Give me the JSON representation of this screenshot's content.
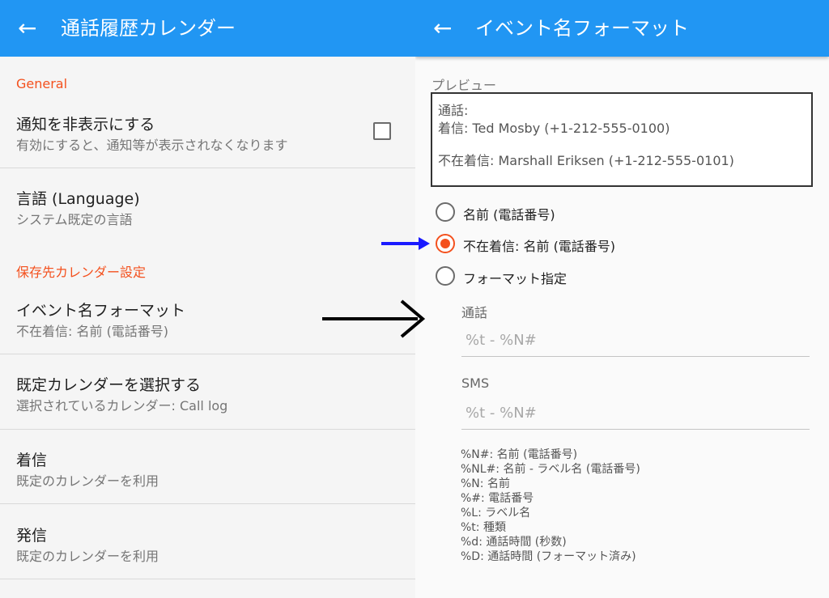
{
  "left_screen": {
    "title": "通話履歴カレンダー",
    "back_glyph": "←",
    "category_general": "General",
    "hide_notification": {
      "title": "通知を非表示にする",
      "summary": "有効にすると、通知等が表示されなくなります",
      "checked": false
    },
    "language": {
      "title": "言語 (Language)",
      "summary": "システム既定の言語"
    },
    "category_calendar": "保存先カレンダー設定",
    "event_name_format": {
      "title": "イベント名フォーマット",
      "summary": "不在着信: 名前 (電話番号)"
    },
    "default_calendar": {
      "title": "既定カレンダーを選択する",
      "summary": "選択されているカレンダー: Call log"
    },
    "incoming": {
      "title": "着信",
      "summary": "既定のカレンダーを利用"
    },
    "outgoing": {
      "title": "発信",
      "summary": "既定のカレンダーを利用"
    }
  },
  "right_screen": {
    "title": "イベント名フォーマット",
    "back_glyph": "←",
    "preview_label": "プレビュー",
    "preview_lines": [
      "通話:",
      "着信: Ted Mosby (+1-212-555-0100)",
      "不在着信: Marshall Eriksen (+1-212-555-0101)"
    ],
    "options": [
      {
        "label": "名前 (電話番号)",
        "selected": false
      },
      {
        "label": "不在着信: 名前 (電話番号)",
        "selected": true
      },
      {
        "label": "フォーマット指定",
        "selected": false
      }
    ],
    "call_field": {
      "label": "通話",
      "placeholder": "%t - %N#"
    },
    "sms_field": {
      "label": "SMS",
      "placeholder": "%t - %N#"
    },
    "help_lines": [
      "%N#: 名前 (電話番号)",
      "%NL#: 名前 - ラベル名 (電話番号)",
      "%N: 名前",
      "%#: 電話番号",
      "%L: ラベル名",
      "%t: 種類",
      "%d: 通話時間 (秒数)",
      "%D: 通話時間 (フォーマット済み)"
    ]
  },
  "colors": {
    "app_bar": "#2196f3",
    "accent": "#f4511e",
    "annotation_arrow_black": "#000000",
    "annotation_arrow_blue": "#1a1aff"
  }
}
